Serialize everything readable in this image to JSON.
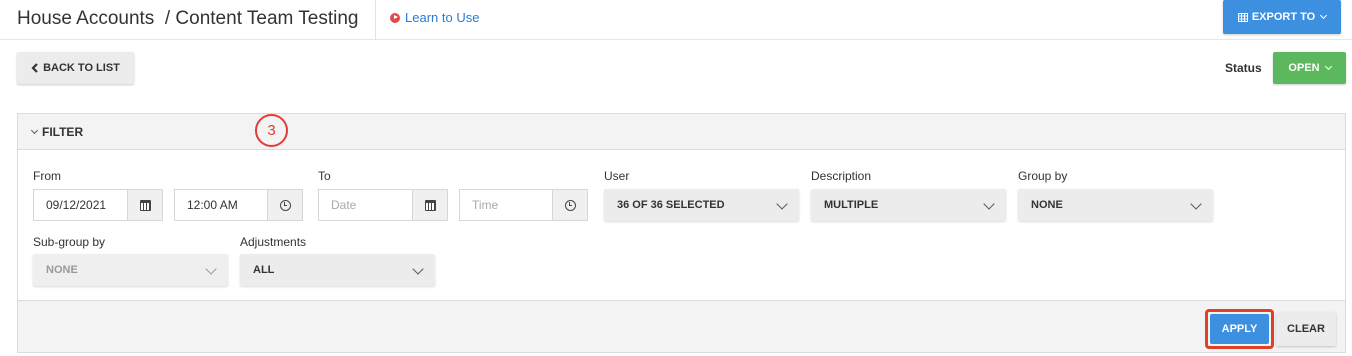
{
  "header": {
    "title": "House Accounts  / Content Team Testing",
    "learn_link": "Learn to Use",
    "export_label": "EXPORT TO"
  },
  "toolbar": {
    "back_label": "BACK TO LIST",
    "status_label": "Status",
    "status_value": "OPEN"
  },
  "filter": {
    "title": "FILTER",
    "step_marker": "3",
    "from": {
      "label": "From",
      "date": "09/12/2021",
      "time": "12:00 AM"
    },
    "to": {
      "label": "To",
      "date_placeholder": "Date",
      "time_placeholder": "Time"
    },
    "user": {
      "label": "User",
      "value": "36 OF 36 SELECTED"
    },
    "description": {
      "label": "Description",
      "value": "MULTIPLE"
    },
    "group_by": {
      "label": "Group by",
      "value": "NONE"
    },
    "sub_group_by": {
      "label": "Sub-group by",
      "value": "NONE"
    },
    "adjustments": {
      "label": "Adjustments",
      "value": "ALL"
    },
    "apply_label": "APPLY",
    "clear_label": "CLEAR"
  },
  "colors": {
    "primary": "#3d8fe0",
    "success": "#5cb85c",
    "highlight": "#e0402a"
  }
}
